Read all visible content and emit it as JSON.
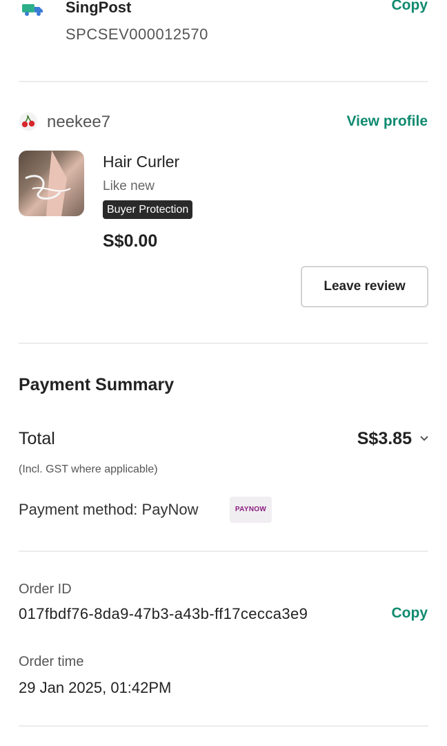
{
  "shipping": {
    "carrier": "SingPost",
    "tracking_number": "SPCSEV000012570",
    "copy_label": "Copy",
    "icon": "truck-icon"
  },
  "seller": {
    "username": "neekee7",
    "view_profile_label": "View profile",
    "avatar_icon": "cherry-icon"
  },
  "item": {
    "title": "Hair Curler",
    "condition": "Like new",
    "badge": "Buyer Protection",
    "price": "S$0.00",
    "leave_review_label": "Leave review"
  },
  "payment_summary": {
    "title": "Payment Summary",
    "total_label": "Total",
    "total_value": "S$3.85",
    "gst_note": "(Incl. GST where applicable)",
    "method_text": "Payment method: PayNow",
    "method_logo": "PAYNOW"
  },
  "order": {
    "id_label": "Order ID",
    "id_value": "017fbdf76-8da9-47b3-a43b-ff17cecca3e9",
    "copy_label": "Copy",
    "time_label": "Order time",
    "time_value": "29 Jan 2025, 01:42PM"
  },
  "colors": {
    "accent_green": "#0f8a6f",
    "badge_bg": "#2a2a2a",
    "paynow_purple": "#8b1d7f"
  }
}
